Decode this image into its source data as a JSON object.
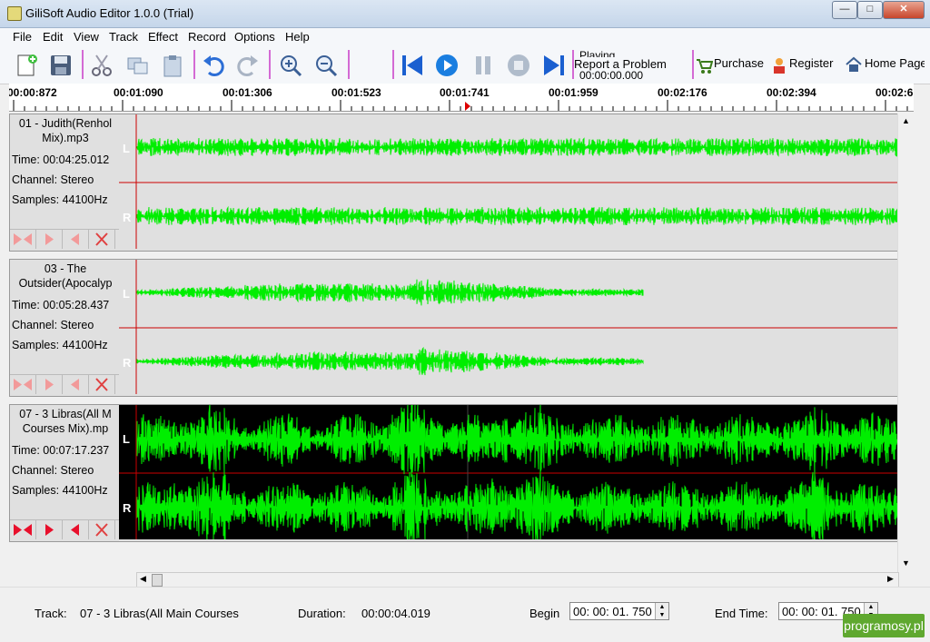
{
  "window": {
    "title": "GiliSoft Audio Editor 1.0.0 (Trial)"
  },
  "menu": [
    "File",
    "Edit",
    "View",
    "Track",
    "Effect",
    "Record",
    "Options",
    "Help"
  ],
  "toolbar": {
    "playing_label": "Playing",
    "time": "00:00:00.000",
    "report": "Report a Problem",
    "purchase": "Purchase",
    "register": "Register",
    "home": "Home Page"
  },
  "ruler": [
    "00:00:872",
    "00:01:090",
    "00:01:306",
    "00:01:523",
    "00:01:741",
    "00:01:959",
    "00:02:176",
    "00:02:394",
    "00:02:6"
  ],
  "tracks": [
    {
      "name": "01 - Judith(Renhol\nMix).mp3",
      "time": "Time: 00:04:25.012",
      "channel": "Channel: Stereo",
      "samples": "Samples: 44100Hz",
      "left": "L",
      "right": "R"
    },
    {
      "name": "03 - The\nOutsider(Apocalyp",
      "time": "Time: 00:05:28.437",
      "channel": "Channel: Stereo",
      "samples": "Samples: 44100Hz",
      "left": "L",
      "right": "R"
    },
    {
      "name": "07 - 3 Libras(All M\nCourses Mix).mp",
      "time": "Time: 00:07:17.237",
      "channel": "Channel: Stereo",
      "samples": "Samples: 44100Hz",
      "left": "L",
      "right": "R"
    }
  ],
  "status": {
    "track_label": "Track:",
    "track_value": "07 - 3 Libras(All Main Courses",
    "duration_label": "Duration:",
    "duration_value": "00:00:04.019",
    "begin_label": "Begin",
    "begin_value": "00: 00: 01. 750",
    "end_label": "End Time:",
    "end_value": "00: 00: 01. 750"
  },
  "watermark": "programosy.pl",
  "colors": {
    "wave": "#00ff00",
    "cursor": "#cc0000",
    "selected_bg": "#000000",
    "track_bg": "#e0e0e0"
  }
}
